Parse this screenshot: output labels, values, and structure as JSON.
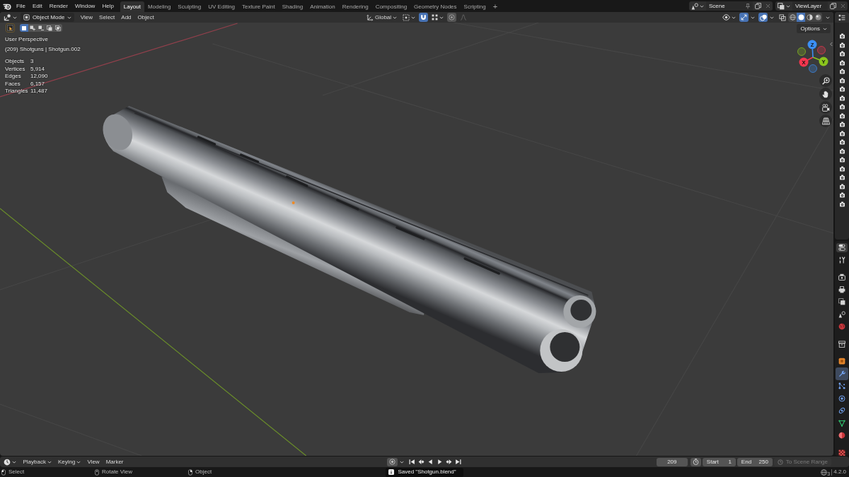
{
  "topbar": {
    "menus": [
      "File",
      "Edit",
      "Render",
      "Window",
      "Help"
    ],
    "workspaces": [
      {
        "label": "Layout",
        "selected": true
      },
      {
        "label": "Modeling",
        "selected": false
      },
      {
        "label": "Sculpting",
        "selected": false
      },
      {
        "label": "UV Editing",
        "selected": false
      },
      {
        "label": "Texture Paint",
        "selected": false
      },
      {
        "label": "Shading",
        "selected": false
      },
      {
        "label": "Animation",
        "selected": false
      },
      {
        "label": "Rendering",
        "selected": false
      },
      {
        "label": "Compositing",
        "selected": false
      },
      {
        "label": "Geometry Nodes",
        "selected": false
      },
      {
        "label": "Scripting",
        "selected": false
      }
    ],
    "add_workspace": "+",
    "scene": "Scene",
    "view_layer": "ViewLayer"
  },
  "viewport_header": {
    "mode": "Object Mode",
    "menus": [
      "View",
      "Select",
      "Add",
      "Object"
    ],
    "orientation": "Global",
    "snapping_on": true,
    "proportional_editing_on": false,
    "gizmos_on": true,
    "overlays_on": true,
    "xray_on": false,
    "shading_modes": [
      {
        "kind": "wireframe",
        "selected": false
      },
      {
        "kind": "solid",
        "selected": true
      },
      {
        "kind": "material",
        "selected": false
      },
      {
        "kind": "rendered",
        "selected": false
      }
    ]
  },
  "tool_header": {
    "selection_modes": [
      {
        "kind": "set",
        "selected": true
      },
      {
        "kind": "extend",
        "selected": false
      },
      {
        "kind": "subtract",
        "selected": false
      },
      {
        "kind": "invert",
        "selected": false
      },
      {
        "kind": "intersect",
        "selected": false
      }
    ],
    "options": "Options"
  },
  "viewport_overlay": {
    "view": "User Perspective",
    "context": "(209) Shotguns | Shotgun.002",
    "stats": [
      {
        "label": "Objects",
        "value": "3"
      },
      {
        "label": "Vertices",
        "value": "5,914"
      },
      {
        "label": "Edges",
        "value": "12,090"
      },
      {
        "label": "Faces",
        "value": "6,157"
      },
      {
        "label": "Triangles",
        "value": "11,487"
      }
    ]
  },
  "navigation_gizmo": {
    "axes": [
      {
        "label": "X",
        "color": "#f5364f"
      },
      {
        "label": "Y",
        "color": "#8ac51d"
      },
      {
        "label": "Z",
        "color": "#3b8ff5"
      }
    ]
  },
  "outliner": {
    "rows": [
      {
        "renderable": true
      },
      {
        "renderable": true
      },
      {
        "renderable": true
      },
      {
        "renderable": true
      },
      {
        "renderable": true
      },
      {
        "renderable": true
      },
      {
        "renderable": true
      },
      {
        "renderable": true
      },
      {
        "renderable": true
      },
      {
        "renderable": true
      },
      {
        "renderable": true
      },
      {
        "renderable": true
      },
      {
        "renderable": true
      },
      {
        "renderable": true
      },
      {
        "renderable": true
      },
      {
        "renderable": true
      },
      {
        "renderable": true
      },
      {
        "renderable": true
      },
      {
        "renderable": true
      },
      {
        "renderable": true
      }
    ]
  },
  "properties_tabs": [
    {
      "kind": "tool",
      "selected": false
    },
    {
      "kind": "render",
      "selected": false
    },
    {
      "kind": "output",
      "selected": false
    },
    {
      "kind": "view_layer",
      "selected": false
    },
    {
      "kind": "scene",
      "selected": false
    },
    {
      "kind": "world",
      "selected": false
    },
    {
      "kind": "collection",
      "selected": false
    },
    {
      "kind": "object",
      "selected": false
    },
    {
      "kind": "modifiers",
      "selected": true
    },
    {
      "kind": "particles",
      "selected": false
    },
    {
      "kind": "physics",
      "selected": false
    },
    {
      "kind": "constraints",
      "selected": false
    },
    {
      "kind": "data",
      "selected": false
    },
    {
      "kind": "material",
      "selected": false
    },
    {
      "kind": "texture",
      "selected": false
    }
  ],
  "timeline": {
    "menus": [
      {
        "label": "Playback",
        "kind": "dropdown"
      },
      {
        "label": "Keying",
        "kind": "dropdown"
      },
      {
        "label": "View",
        "kind": "menu"
      },
      {
        "label": "Marker",
        "kind": "menu"
      }
    ],
    "auto_keying_on": false,
    "current_frame": "209",
    "preview_range_on": false,
    "start_label": "Start",
    "start": "1",
    "end_label": "End",
    "end": "250",
    "scene_range": {
      "label": "To Scene Range",
      "disabled": true
    }
  },
  "status_bar": {
    "hints": [
      {
        "label": "Select",
        "kind": "left"
      },
      {
        "label": "Rotate View",
        "kind": "middle"
      },
      {
        "label": "Object",
        "kind": "right"
      }
    ],
    "notification": "Saved \"Shotgun.blend\"",
    "extension_updates": "3",
    "version": "4.2.0"
  }
}
